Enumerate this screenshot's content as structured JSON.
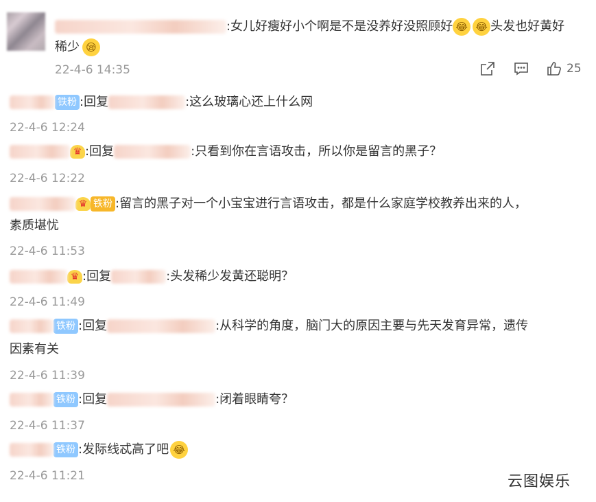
{
  "post": {
    "text_part1": ":女儿好瘦好小个啊是不是没养好没照顾好",
    "text_part2": "头发也好黄好",
    "text_line2": "稀少",
    "time": "22-4-6 14:35",
    "like_count": "25"
  },
  "replies": [
    {
      "badge": "铁粉",
      "prefix": ":回复",
      "text": ":这么玻璃心还上什么网",
      "time": "22-4-6 12:24"
    },
    {
      "prefix": ":回复",
      "text": ":只看到你在言语攻击，所以你是留言的黑子？",
      "time": "22-4-6 12:22"
    },
    {
      "badge": "铁粉",
      "text": ":留言的黑子对一个小宝宝进行言语攻击，都是什么家庭学校教养出来的人，",
      "line2": "素质堪忧",
      "time": "22-4-6 11:53"
    },
    {
      "prefix": ":回复",
      "text": ":头发稀少发黄还聪明？",
      "time": "22-4-6 11:49"
    },
    {
      "badge": "铁粉",
      "prefix": ":回复",
      "text": ":从科学的角度，脑门大的原因主要与先天发育异常，遗传",
      "line2": "因素有关",
      "time": "22-4-6 11:39"
    },
    {
      "badge": "铁粉",
      "prefix": ":回复",
      "text": ":闭着眼睛夸？",
      "time": "22-4-6 11:37"
    },
    {
      "badge": "铁粉",
      "text": ":发际线忒高了吧",
      "time": "22-4-6 11:21"
    }
  ],
  "watermark": "云图娱乐",
  "colors": {
    "fan_badge": "#8fc8ff",
    "gold_badge": "#f7b72a",
    "time": "#999999"
  },
  "icons": [
    "share-icon",
    "comment-icon",
    "like-icon",
    "laugh-cry-emoji",
    "sleepy-emoji",
    "crown-icon"
  ]
}
